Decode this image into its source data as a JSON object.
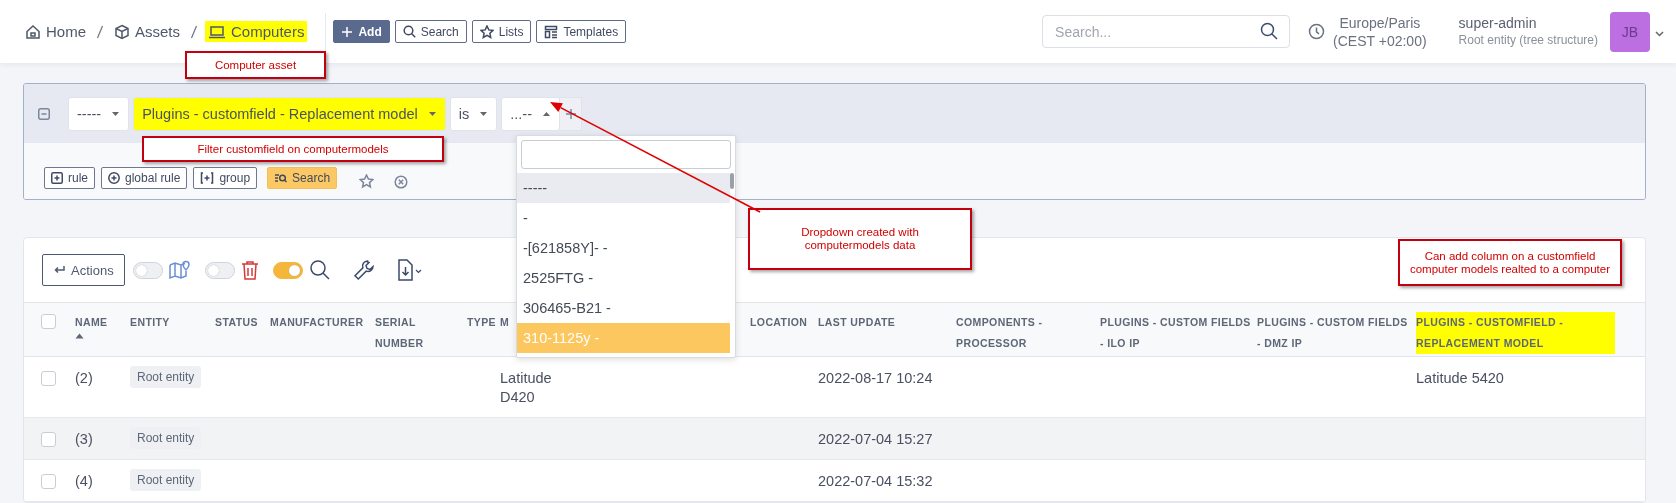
{
  "breadcrumb": [
    {
      "label": "Home",
      "highlighted": false
    },
    {
      "label": "Assets",
      "highlighted": false
    },
    {
      "label": "Computers",
      "highlighted": true
    }
  ],
  "header_buttons": [
    {
      "label": "Add",
      "kind": "add"
    },
    {
      "label": "Search",
      "kind": "search"
    },
    {
      "label": "Lists",
      "kind": "lists"
    },
    {
      "label": "Templates",
      "kind": "templates"
    }
  ],
  "global_search": {
    "placeholder": "Search..."
  },
  "timezone": {
    "name": "Europe/Paris",
    "offset": "(CEST +02:00)"
  },
  "user": {
    "name": "super-admin",
    "entity": "Root entity (tree structure)",
    "initials": "JB"
  },
  "filter": {
    "criteria": [
      {
        "value": "-----",
        "highlighted": false,
        "expanded": false
      },
      {
        "value": "Plugins - customfield - Replacement model",
        "highlighted": true,
        "expanded": false
      },
      {
        "value": "is",
        "highlighted": false,
        "expanded": false
      },
      {
        "value": "...--",
        "highlighted": false,
        "expanded": true
      }
    ],
    "actions": [
      {
        "label": "rule",
        "kind": "rule"
      },
      {
        "label": "global rule",
        "kind": "global"
      },
      {
        "label": "group",
        "kind": "group"
      },
      {
        "label": "Search",
        "kind": "search"
      }
    ]
  },
  "dropdown": {
    "options": [
      {
        "label": "-----",
        "selected": true,
        "hovered": false
      },
      {
        "label": "-",
        "selected": false,
        "hovered": false
      },
      {
        "label": "-[621858Y]- -",
        "selected": false,
        "hovered": false
      },
      {
        "label": "2525FTG -",
        "selected": false,
        "hovered": false
      },
      {
        "label": "306465-B21 -",
        "selected": false,
        "hovered": false
      },
      {
        "label": "310-1125y -",
        "selected": false,
        "hovered": true
      }
    ]
  },
  "table_toolbar": {
    "actions_button": "Actions",
    "toggles": [
      {
        "on": false
      },
      {
        "on": false
      },
      {
        "on": true
      }
    ]
  },
  "table": {
    "select_all": {
      "checked": false
    },
    "columns": [
      {
        "label": "NAME",
        "sorted": true,
        "highlighted": false
      },
      {
        "label": "ENTITY",
        "sorted": false,
        "highlighted": false
      },
      {
        "label": "STATUS",
        "sorted": false,
        "highlighted": false
      },
      {
        "label": "MANUFACTURER",
        "sorted": false,
        "highlighted": false
      },
      {
        "label": "SERIAL NUMBER",
        "sorted": false,
        "highlighted": false
      },
      {
        "label": "TYPE",
        "sorted": false,
        "highlighted": false
      },
      {
        "label": "M",
        "sorted": false,
        "highlighted": false
      },
      {
        "label": "LOCATION",
        "sorted": false,
        "highlighted": false
      },
      {
        "label": "LAST UPDATE",
        "sorted": false,
        "highlighted": false
      },
      {
        "label": "COMPONENTS - PROCESSOR",
        "sorted": false,
        "highlighted": false
      },
      {
        "label": "PLUGINS - CUSTOM FIELDS - ILO IP",
        "sorted": false,
        "highlighted": false
      },
      {
        "label": "PLUGINS - CUSTOM FIELDS - DMZ IP",
        "sorted": false,
        "highlighted": false
      },
      {
        "label": "PLUGINS - CUSTOMFIELD - REPLACEMENT MODEL",
        "sorted": false,
        "highlighted": true
      }
    ],
    "rows": [
      {
        "checked": false,
        "name": "(2)",
        "entity": "Root entity",
        "model": "Latitude D420",
        "last_update": "2022-08-17 10:24",
        "replacement_model": "Latitude 5420"
      },
      {
        "checked": false,
        "name": "(3)",
        "entity": "Root entity",
        "last_update": "2022-07-04 15:27"
      },
      {
        "checked": false,
        "name": "(4)",
        "entity": "Root entity",
        "last_update": "2022-07-04 15:32"
      }
    ]
  },
  "annotations": [
    {
      "text": "Computer asset"
    },
    {
      "text": "Filter customfield on computermodels"
    },
    {
      "text": "Dropdown created with computermodels data"
    },
    {
      "text": "Can add column on a customfield computer models realted to a computer"
    }
  ]
}
